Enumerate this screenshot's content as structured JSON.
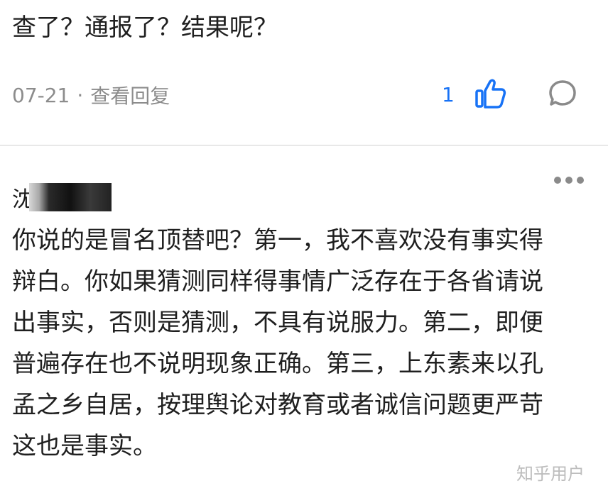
{
  "top_comment": {
    "text": "查了？通报了？结果呢？",
    "meta": {
      "date": "07-21",
      "separator": "·",
      "reply_label": "查看回复"
    },
    "like_count": "1",
    "icons": {
      "like": "thumbs-up-icon",
      "comment": "comment-bubble-icon"
    },
    "colors": {
      "accent": "#1772f6",
      "meta_text": "#8c8c8c",
      "icon_gray": "#8a8a8a"
    }
  },
  "reply_comment": {
    "username_visible": "沈",
    "more_icon": "more-dots-icon",
    "body_lines": [
      "你说的是冒名顶替吧？第一，我不喜欢没有事实得",
      "辩白。你如果猜测同样得事情广泛存在于各省请说",
      "出事实，否则是猜测，不具有说服力。第二，即便",
      "普遍存在也不说明现象正确。第三，上东素来以孔",
      "孟之乡自居，按理舆论对教育或者诚信问题更严苛",
      "这也是事实。"
    ]
  },
  "watermark": "知乎用户"
}
